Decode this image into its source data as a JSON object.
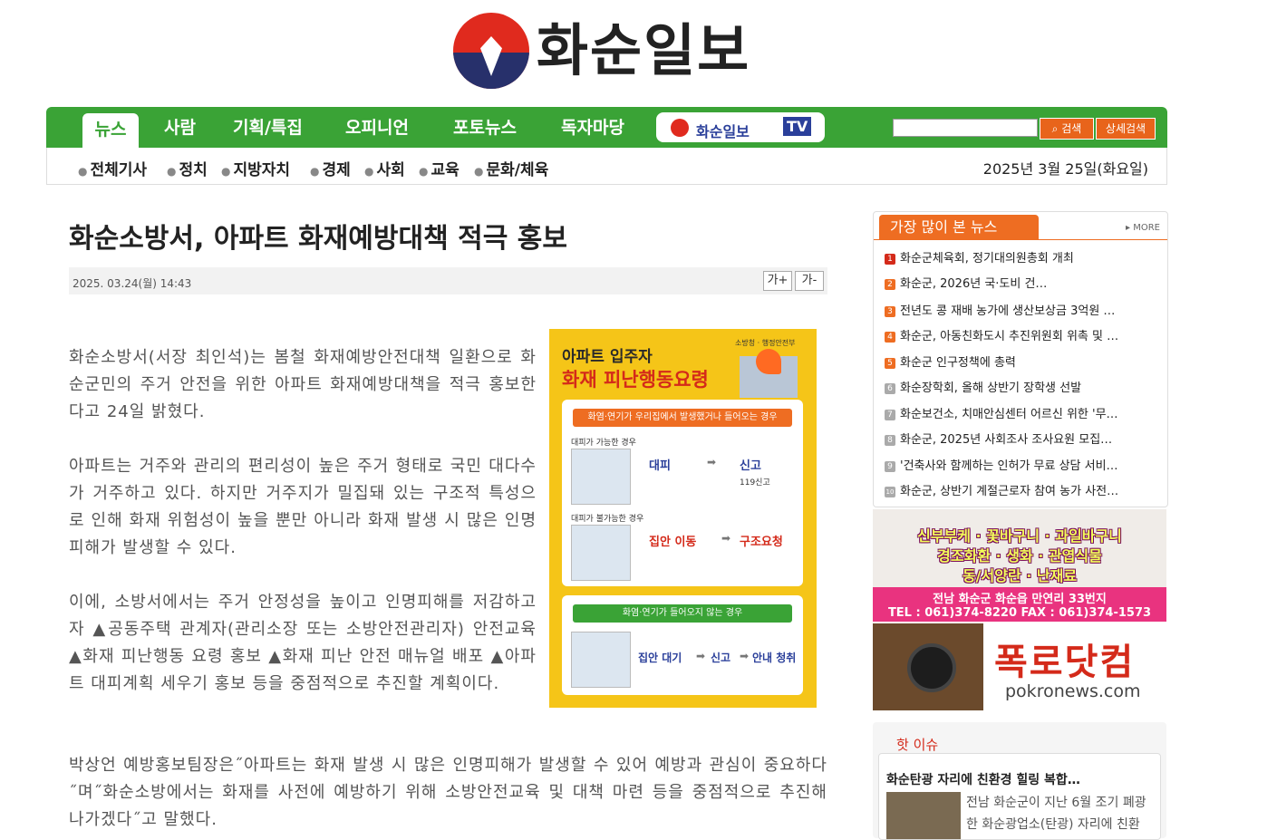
{
  "site": {
    "logo_text": "화순일보"
  },
  "nav": {
    "items": [
      "뉴스",
      "사람",
      "기획/특집",
      "오피니언",
      "포토뉴스",
      "독자마당"
    ],
    "tv_label": "화순일보",
    "tv_tag": "TV",
    "search_placeholder": "",
    "search_button": "검색",
    "detail_search_button": "상세검색"
  },
  "subnav": {
    "items": [
      "전체기사",
      "정치",
      "지방자치",
      "경제",
      "사회",
      "교육",
      "문화/체육"
    ],
    "date": "2025년 3월 25일(화요일)"
  },
  "article": {
    "title": "화순소방서, 아파트 화재예방대책 적극 홍보",
    "timestamp": "2025. 03.24(월) 14:43",
    "font_up": "가+",
    "font_down": "가-",
    "paragraphs": [
      "화순소방서(서장 최인석)는 봄철 화재예방안전대책 일환으로 화순군민의 주거 안전을 위한 아파트 화재예방대책을 적극 홍보한다고 24일 밝혔다.",
      "아파트는 거주와 관리의 편리성이 높은 주거 형태로 국민 대다수가 거주하고 있다. 하지만 거주지가 밀집돼 있는 구조적 특성으로 인해 화재 위험성이 높을 뿐만 아니라 화재 발생 시 많은 인명피해가 발생할 수 있다.",
      "이에, 소방서에서는 주거 안정성을 높이고 인명피해를 저감하고자 ▲공동주택 관계자(관리소장 또는 소방안전관리자) 안전교육 ▲화재 피난행동 요령 홍보 ▲화재 피난 안전 매뉴얼 배포 ▲아파트 대피계획 세우기 홍보 등을 중점적으로 추진할 계획이다.",
      "박상언 예방홍보팀장은˝아파트는 화재 발생 시 많은 인명피해가 발생할 수 있어 예방과 관심이 중요하다˝며˝화순소방에서는 화재를 사전에 예방하기 위해 소방안전교육 및 대책 마련 등을 중점적으로 추진해 나가겠다˝고 말했다."
    ]
  },
  "poster": {
    "title1": "아파트 입주자",
    "title2": "화재 피난행동요령",
    "org": "소방청 · 행정안전부",
    "section1": "화염·연기가 우리집에서 발생했거나 들어오는 경우",
    "case1": "대피가 가능한 경우",
    "case1_act1": "대피",
    "case1_act2": "신고",
    "case2": "대피가 불가능한 경우",
    "case2_act1": "집안 이동",
    "case2_act2": "구조요청",
    "section2": "화염·연기가 들어오지 않는 경우",
    "case3_act1": "집안 대기",
    "case3_act2": "신고",
    "case3_act3": "안내 청취",
    "label_119": "119신고"
  },
  "most_viewed": {
    "title": "가장 많이 본 뉴스",
    "more": "▸ MORE",
    "items": [
      "화순군체육회, 정기대의원총회 개최",
      "화순군, 2026년 국·도비 건…",
      "전년도 콩 재배 농가에 생산보상금 3억원 …",
      "화순군, 아동친화도시 추진위원회 위촉 및 …",
      "화순군 인구정책에 총력",
      "화순장학회, 올해 상반기 장학생 선발",
      "화순보건소, 치매안심센터 어르신 위한 '무…",
      "화순군, 2025년 사회조사 조사요원 모집…",
      "'건축사와 함께하는 인허가 무료 상담 서비…",
      "화순군, 상반기 계절근로자 참여 농가 사전…"
    ],
    "colors": {
      "top": "#d42a1a",
      "mid": "#ee6d22",
      "rest": "#aaaaaa"
    }
  },
  "ad_flower": {
    "line1": "신부부케 · 꽃바구니 · 과일바구니",
    "line2": "경조화환 · 생화 · 관엽식물",
    "line3": "동/서양란 · 난재료",
    "addr": "전남 화순군 화순읍 만연리 33번지",
    "phone": "TEL : 061)374-8220 FAX : 061)374-1573"
  },
  "ad_pokro": {
    "brand": "폭로닷컴",
    "url": "pokronews.com"
  },
  "hot_issue": {
    "header": "핫 이슈",
    "title": "화순탄광 자리에 친환경 힐링 복합…",
    "desc": "전남 화순군이 지난 6월 조기 폐광한 화순광업소(탄광) 자리에 친환"
  },
  "colors": {
    "green": "#3aa336",
    "orange": "#ee6d22",
    "red": "#d42a1a",
    "navy": "#27306b"
  }
}
